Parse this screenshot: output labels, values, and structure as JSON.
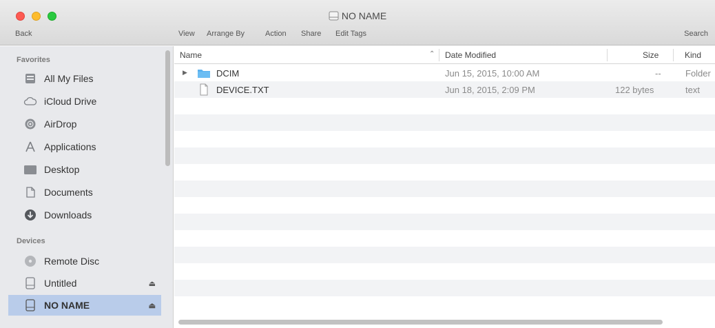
{
  "window": {
    "title": "NO NAME"
  },
  "toolbar": {
    "back": "Back",
    "view": "View",
    "arrange_by": "Arrange By",
    "action": "Action",
    "share": "Share",
    "edit_tags": "Edit Tags",
    "search": "Search"
  },
  "sidebar": {
    "favorites_header": "Favorites",
    "favorites": [
      {
        "label": "All My Files",
        "icon": "all-files-icon"
      },
      {
        "label": "iCloud Drive",
        "icon": "cloud-icon"
      },
      {
        "label": "AirDrop",
        "icon": "airdrop-icon"
      },
      {
        "label": "Applications",
        "icon": "applications-icon"
      },
      {
        "label": "Desktop",
        "icon": "desktop-icon"
      },
      {
        "label": "Documents",
        "icon": "documents-icon"
      },
      {
        "label": "Downloads",
        "icon": "downloads-icon"
      }
    ],
    "devices_header": "Devices",
    "devices": [
      {
        "label": "Remote Disc",
        "icon": "remote-disc-icon"
      },
      {
        "label": "Untitled",
        "icon": "drive-icon",
        "eject": "⏏"
      },
      {
        "label": "NO NAME",
        "icon": "drive-icon",
        "eject": "⏏",
        "selected": true
      }
    ]
  },
  "columns": {
    "name": "Name",
    "date_modified": "Date Modified",
    "size": "Size",
    "kind": "Kind"
  },
  "files": [
    {
      "name": "DCIM",
      "date": "Jun 15, 2015, 10:00 AM",
      "size": "--",
      "kind": "Folder",
      "icon": "folder-icon"
    },
    {
      "name": "DEVICE.TXT",
      "date": "Jun 18, 2015, 2:09 PM",
      "size": "122 bytes",
      "kind": "text",
      "icon": "text-file-icon"
    }
  ],
  "colors": {
    "selection": "#b9ccea",
    "folder": "#5ab1ef"
  }
}
